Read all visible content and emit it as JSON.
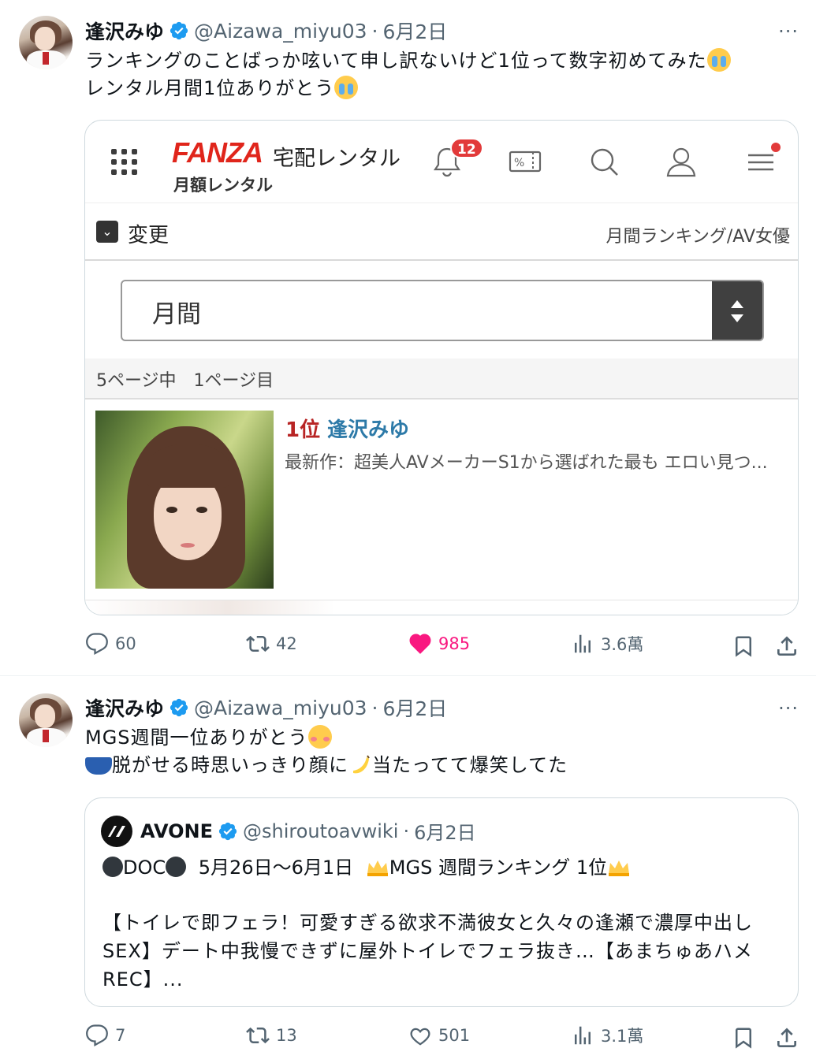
{
  "tweets": [
    {
      "name": "逢沢みゆ",
      "handle": "@Aizawa_miyu03",
      "sep": "·",
      "date": "6月2日",
      "more": "···",
      "text_line1": "ランキングのことばっか呟いて申し訳ないけど1位って数字初めてみた",
      "text_line2": "レンタル月間1位ありがとう",
      "media": {
        "logo": "FANZA",
        "service": "宅配レンタル",
        "sub": "月額レンタル",
        "badge": "12",
        "change": "変更",
        "crumb": "月間ランキング/AV女優",
        "select_value": "月間",
        "page_info": "5ページ中　1ページ目",
        "rank": "1位",
        "actress": "逢沢みゆ",
        "desc": "最新作：超美人AVメーカーS1から選ばれた最も エロい見つ..."
      },
      "actions": {
        "replies": "60",
        "reposts": "42",
        "likes": "985",
        "views": "3.6萬"
      }
    },
    {
      "name": "逢沢みゆ",
      "handle": "@Aizawa_miyu03",
      "sep": "·",
      "date": "6月2日",
      "more": "···",
      "text_line1": "MGS週間一位ありがとう",
      "text_line2": "脱がせる時思いっきり顔に",
      "text_line2b": "当たってて爆笑してた",
      "quote": {
        "name": "AVONE",
        "handle": "@shiroutoavwiki",
        "sep": "·",
        "date": "6月2日",
        "doc": "DOC",
        "period": "5月26日〜6月1日",
        "ranking": "MGS 週間ランキング 1位",
        "body": "【トイレで即フェラ！可愛すぎる欲求不満彼女と久々の逢瀬で濃厚中出しSEX】デート中我慢できずに屋外トイレでフェラ抜き…【あまちゅあハメREC】..."
      },
      "actions": {
        "replies": "7",
        "reposts": "13",
        "likes": "501",
        "views": "3.1萬"
      }
    }
  ],
  "colors": {
    "like": "#f91880",
    "verified": "#1d9bf0",
    "fanza_red": "#e0251b",
    "muted": "#536471"
  },
  "icons": [
    "verified-icon",
    "more-icon",
    "reply-icon",
    "repost-icon",
    "like-icon",
    "views-icon",
    "bookmark-icon",
    "share-icon",
    "grid-icon",
    "bell-icon",
    "coupon-icon",
    "search-icon",
    "user-icon",
    "menu-icon",
    "chevron-down-icon",
    "sort-icon"
  ]
}
